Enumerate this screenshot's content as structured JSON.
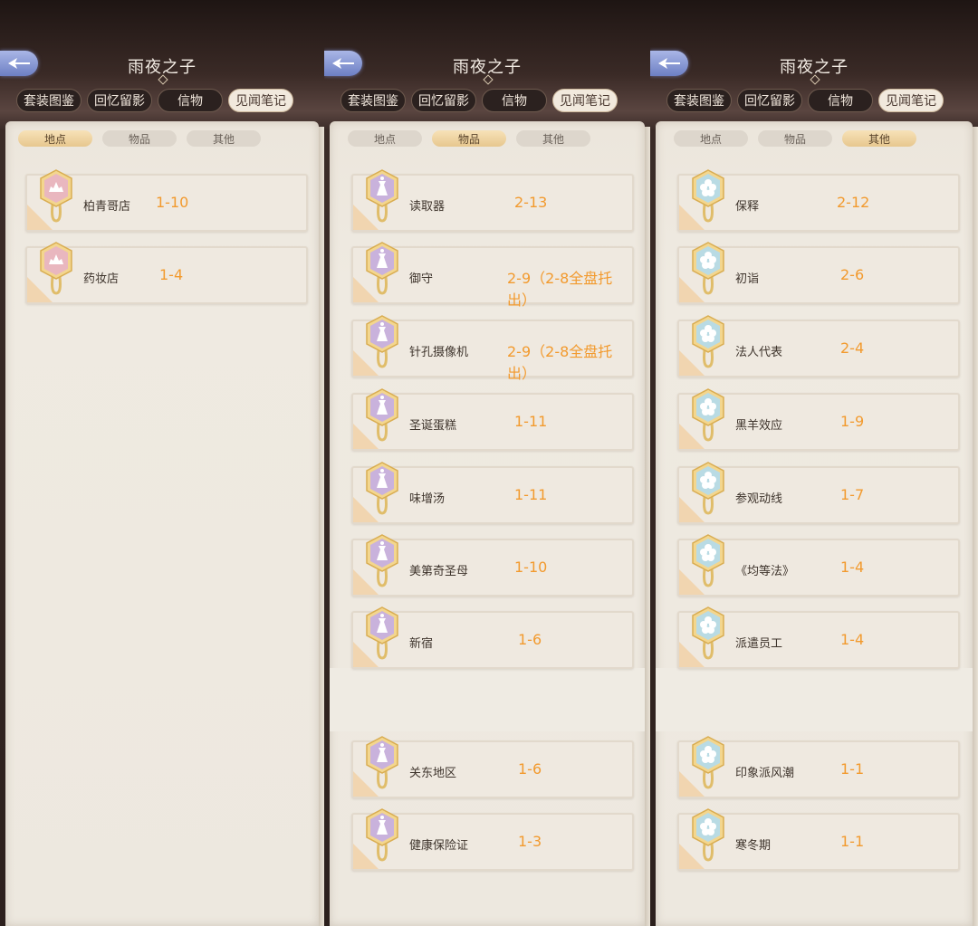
{
  "title": "雨夜之子",
  "tabs": [
    "套装图鉴",
    "回忆留影",
    "信物",
    "见闻笔记"
  ],
  "subtabs": [
    "地点",
    "物品",
    "其他"
  ],
  "colors": {
    "accent_orange": "#f29a2e",
    "badge_pink": "#e9b7bf",
    "badge_purple": "#c9b2dc",
    "badge_blue": "#b9dbe4",
    "badge_gold": "#e8c26e"
  },
  "panels": [
    {
      "active_subtab": 0,
      "items": [
        {
          "name": "柏青哥店",
          "chapter": "1-10"
        },
        {
          "name": "药妆店",
          "chapter": "1-4"
        }
      ]
    },
    {
      "active_subtab": 1,
      "items": [
        {
          "name": "读取器",
          "chapter": "2-13"
        },
        {
          "name": "御守",
          "chapter": "2-9（2-8全盘托出）"
        },
        {
          "name": "针孔摄像机",
          "chapter": "2-9（2-8全盘托出）"
        },
        {
          "name": "圣诞蛋糕",
          "chapter": "1-11"
        },
        {
          "name": "味增汤",
          "chapter": "1-11"
        },
        {
          "name": "美第奇圣母",
          "chapter": "1-10"
        },
        {
          "name": "新宿",
          "chapter": "1-6"
        },
        {
          "name": "关东地区",
          "chapter": "1-6"
        },
        {
          "name": "健康保险证",
          "chapter": "1-3"
        }
      ]
    },
    {
      "active_subtab": 2,
      "items": [
        {
          "name": "保释",
          "chapter": "2-12"
        },
        {
          "name": "初诣",
          "chapter": "2-6"
        },
        {
          "name": "法人代表",
          "chapter": "2-4"
        },
        {
          "name": "黑羊效应",
          "chapter": "1-9"
        },
        {
          "name": "参观动线",
          "chapter": "1-7"
        },
        {
          "name": "《均等法》",
          "chapter": "1-4"
        },
        {
          "name": "派遣员工",
          "chapter": "1-4"
        },
        {
          "name": "印象派风潮",
          "chapter": "1-1"
        },
        {
          "name": "寒冬期",
          "chapter": "1-1"
        }
      ]
    }
  ]
}
